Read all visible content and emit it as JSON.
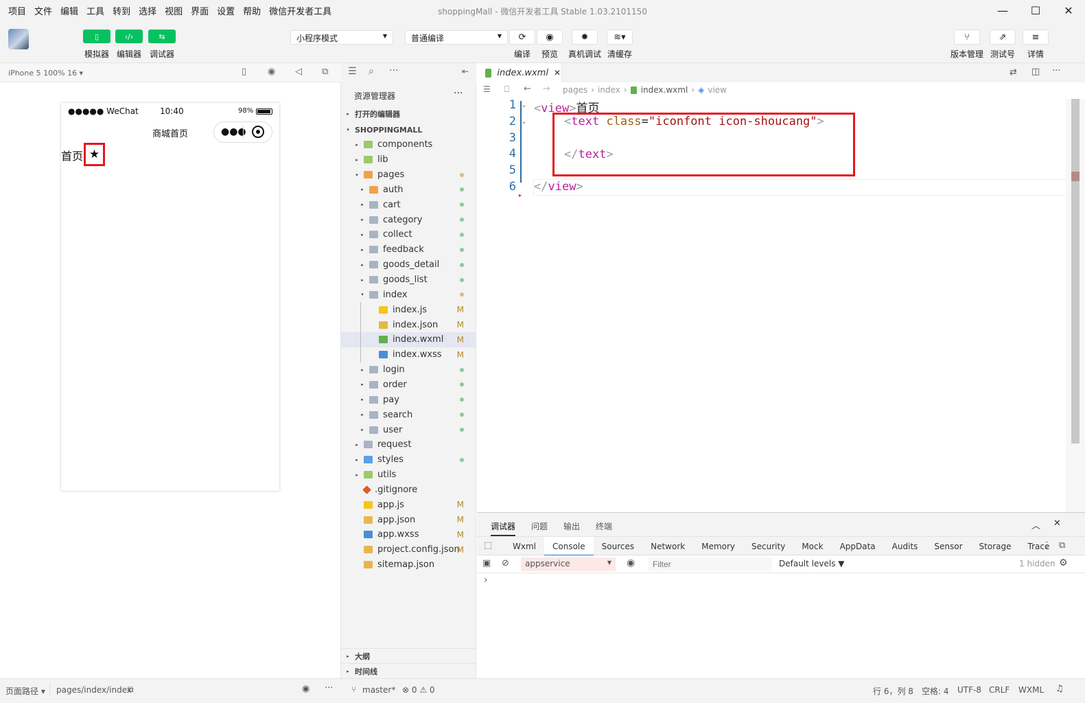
{
  "menubar": {
    "items": [
      "项目",
      "文件",
      "编辑",
      "工具",
      "转到",
      "选择",
      "视图",
      "界面",
      "设置",
      "帮助",
      "微信开发者工具"
    ],
    "title": "shoppingMall - 微信开发者工具 Stable 1.03.2101150"
  },
  "toolbar": {
    "simulator_label": "模拟器",
    "editor_label": "编辑器",
    "debugger_label": "调试器",
    "mode_value": "小程序模式",
    "compile_mode_value": "普通编译",
    "compile_label": "编译",
    "preview_label": "预览",
    "remote_debug_label": "真机调试",
    "clear_cache_label": "清缓存",
    "version_label": "版本管理",
    "test_label": "测试号",
    "detail_label": "详情"
  },
  "simulator": {
    "device": "iPhone 5 100% 16 ▾",
    "status": {
      "signal": "●●●●● WeChat",
      "time": "10:40",
      "battery": "98%"
    },
    "nav_title": "商城首页",
    "content_text": "首页",
    "content_icon": "★"
  },
  "explorer": {
    "title": "资源管理器",
    "open_editors": "打开的编辑器",
    "project": "SHOPPINGMALL",
    "tree": [
      {
        "name": "components",
        "level": 1,
        "kind": "folder-green",
        "arrow": "▸"
      },
      {
        "name": "lib",
        "level": 1,
        "kind": "folder-green",
        "arrow": "▸"
      },
      {
        "name": "pages",
        "level": 1,
        "kind": "folder-orange",
        "arrow": "▾",
        "dot": "#d8b98f"
      },
      {
        "name": "auth",
        "level": 2,
        "kind": "folder-orange",
        "arrow": "▸",
        "dot": "#8fc79a"
      },
      {
        "name": "cart",
        "level": 2,
        "kind": "folder",
        "arrow": "▸",
        "dot": "#8fc79a"
      },
      {
        "name": "category",
        "level": 2,
        "kind": "folder",
        "arrow": "▸",
        "dot": "#8fc79a"
      },
      {
        "name": "collect",
        "level": 2,
        "kind": "folder",
        "arrow": "▸",
        "dot": "#8fc79a"
      },
      {
        "name": "feedback",
        "level": 2,
        "kind": "folder",
        "arrow": "▸",
        "dot": "#8fc79a"
      },
      {
        "name": "goods_detail",
        "level": 2,
        "kind": "folder",
        "arrow": "▸",
        "dot": "#8fc79a"
      },
      {
        "name": "goods_list",
        "level": 2,
        "kind": "folder",
        "arrow": "▸",
        "dot": "#8fc79a"
      },
      {
        "name": "index",
        "level": 2,
        "kind": "folder-open",
        "arrow": "▾",
        "dot": "#d8b98f"
      },
      {
        "name": "index.js",
        "level": 3,
        "kind": "js",
        "status": "M"
      },
      {
        "name": "index.json",
        "level": 3,
        "kind": "json",
        "status": "M"
      },
      {
        "name": "index.wxml",
        "level": 3,
        "kind": "wxml",
        "status": "M",
        "selected": true
      },
      {
        "name": "index.wxss",
        "level": 3,
        "kind": "wxss",
        "status": "M"
      },
      {
        "name": "login",
        "level": 2,
        "kind": "folder",
        "arrow": "▸",
        "dot": "#8fc79a"
      },
      {
        "name": "order",
        "level": 2,
        "kind": "folder",
        "arrow": "▸",
        "dot": "#8fc79a"
      },
      {
        "name": "pay",
        "level": 2,
        "kind": "folder",
        "arrow": "▸",
        "dot": "#8fc79a"
      },
      {
        "name": "search",
        "level": 2,
        "kind": "folder",
        "arrow": "▸",
        "dot": "#8fc79a"
      },
      {
        "name": "user",
        "level": 2,
        "kind": "folder",
        "arrow": "▸",
        "dot": "#8fc79a"
      },
      {
        "name": "request",
        "level": 1,
        "kind": "folder",
        "arrow": "▸"
      },
      {
        "name": "styles",
        "level": 1,
        "kind": "folder-blue",
        "arrow": "▸",
        "dot": "#8fc79a"
      },
      {
        "name": "utils",
        "level": 1,
        "kind": "folder-green",
        "arrow": "▸"
      },
      {
        "name": ".gitignore",
        "level": 1,
        "kind": "git"
      },
      {
        "name": "app.js",
        "level": 1,
        "kind": "js",
        "status": "M"
      },
      {
        "name": "app.json",
        "level": 1,
        "kind": "json",
        "status": "M"
      },
      {
        "name": "app.wxss",
        "level": 1,
        "kind": "wxss",
        "status": "M"
      },
      {
        "name": "project.config.json",
        "level": 1,
        "kind": "json",
        "status": "M"
      },
      {
        "name": "sitemap.json",
        "level": 1,
        "kind": "json"
      }
    ],
    "outline": "大纲",
    "timeline": "时间线"
  },
  "editor": {
    "tab": "index.wxml",
    "breadcrumb": [
      "pages",
      "index",
      "index.wxml",
      "view"
    ],
    "line_numbers": [
      "1",
      "2",
      "3",
      "4",
      "5",
      "6"
    ]
  },
  "devtools": {
    "top_tabs": [
      "调试器",
      "问题",
      "输出",
      "终端"
    ],
    "panel_tabs": [
      "Wxml",
      "Console",
      "Sources",
      "Network",
      "Memory",
      "Security",
      "Mock",
      "AppData",
      "Audits",
      "Sensor",
      "Storage",
      "Trace"
    ],
    "context": "appservice",
    "filter_placeholder": "Filter",
    "levels": "Default levels ▼",
    "hidden": "1 hidden",
    "prompt": "›"
  },
  "statusbar": {
    "page_path_label": "页面路径 ▾",
    "page_path": "pages/index/index",
    "branch": "master*",
    "problems": "⊗ 0 ⚠ 0",
    "cursor": "行 6，列 8",
    "indent": "空格: 4",
    "encoding": "UTF-8",
    "eol": "CRLF",
    "lang": "WXML"
  },
  "colors": {
    "accent_green": "#07c160",
    "highlight_red": "#e6161e"
  }
}
